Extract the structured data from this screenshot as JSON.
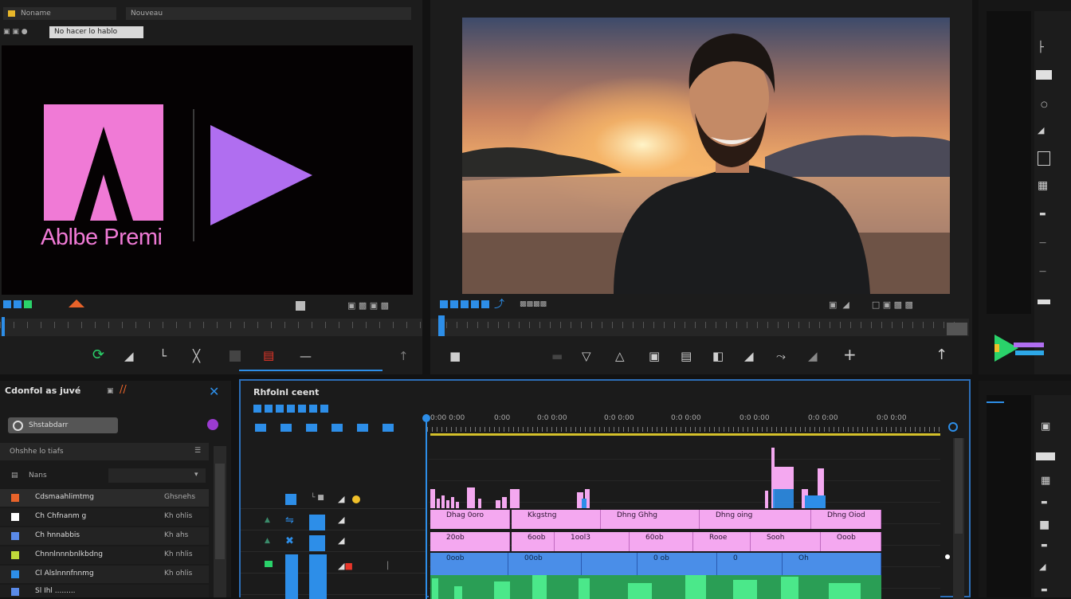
{
  "source_monitor": {
    "top_field_1": "Noname",
    "top_field_2": "Nouveau",
    "tab_label": "No hacer lo hablo",
    "logo_text": "Ablbe Premi",
    "accent_pink": "#f07ad6",
    "accent_purple": "#b06ef0"
  },
  "program_monitor": {
    "accent_blue": "#2d8ee8"
  },
  "project_panel": {
    "title": "Cdonfol as juvé",
    "search_placeholder": "Shstabdarr",
    "filter_label": "Ohshhe lo tiafs",
    "column_name": "Nans",
    "items": [
      {
        "name": "Cdsmaahlimtmg",
        "meta": "Ghsnehs",
        "color": "#e8632a"
      },
      {
        "name": "Ch Chfnanm g",
        "meta": "Kh ohlis",
        "color": "#ffffff"
      },
      {
        "name": "Ch hnnabbis",
        "meta": "Kh ahs",
        "color": "#5a8ae8"
      },
      {
        "name": "Chnnlnnnbnlkbdng",
        "meta": "Kh nhlis",
        "color": "#c0d93a"
      },
      {
        "name": "Cl Alslnnnfnnmg",
        "meta": "Kh ohlis",
        "color": "#2d8ee8"
      },
      {
        "name": "Sl Ihl .........",
        "meta": "",
        "color": "#5a8ae8"
      }
    ]
  },
  "timeline": {
    "title": "Rhfolnl ceent",
    "ruler": [
      "0:00 0:00",
      "0:00",
      "0:0 0:00",
      "0:0 0:00",
      "0:0 0:00",
      "0:0 0:00",
      "0:0 0:00",
      "0:0 0:00"
    ],
    "video_clips_row1": [
      "Dhag 0oro",
      "Kkgstng",
      "Dhng Ghhg",
      "Dhng oing",
      "Dhng Oiod"
    ],
    "video_clips_row2": [
      "20ob",
      "6oob",
      "1ool3",
      "60ob",
      "Rooe",
      "Sooh",
      "Ooob"
    ],
    "audio_clips": [
      "0oob",
      "00ob",
      "",
      "0 ob",
      "0",
      "Oh"
    ]
  }
}
